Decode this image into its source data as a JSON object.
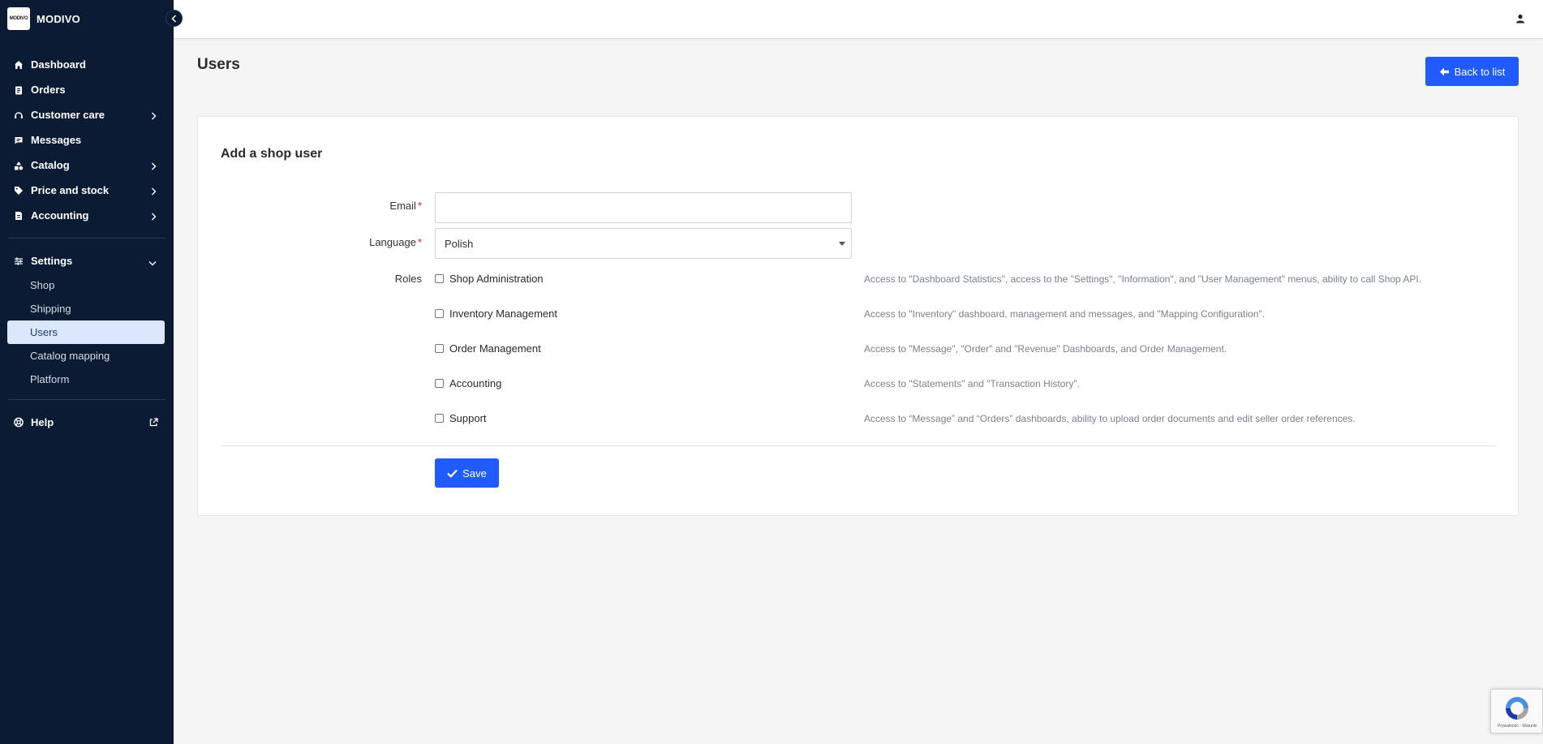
{
  "brand": {
    "logo_text": "MODIVO",
    "name": "MODIVO"
  },
  "sidebar": {
    "items": [
      {
        "label": "Dashboard",
        "icon": "home-icon",
        "has_chevron": false
      },
      {
        "label": "Orders",
        "icon": "clipboard-icon",
        "has_chevron": false
      },
      {
        "label": "Customer care",
        "icon": "headset-icon",
        "has_chevron": true
      },
      {
        "label": "Messages",
        "icon": "message-icon",
        "has_chevron": false
      },
      {
        "label": "Catalog",
        "icon": "shapes-icon",
        "has_chevron": true
      },
      {
        "label": "Price and stock",
        "icon": "tag-icon",
        "has_chevron": true
      },
      {
        "label": "Accounting",
        "icon": "invoice-icon",
        "has_chevron": true
      }
    ],
    "settings": {
      "label": "Settings",
      "icon": "sliders-icon",
      "expanded": true,
      "sub_items": [
        {
          "label": "Shop",
          "active": false
        },
        {
          "label": "Shipping",
          "active": false
        },
        {
          "label": "Users",
          "active": true
        },
        {
          "label": "Catalog mapping",
          "active": false
        },
        {
          "label": "Platform",
          "active": false
        }
      ]
    },
    "help": {
      "label": "Help",
      "icon": "lifebuoy-icon",
      "external_icon": "external-link-icon"
    }
  },
  "header": {
    "title": "Users",
    "back_button": "Back to list"
  },
  "form": {
    "title": "Add a shop user",
    "email": {
      "label": "Email",
      "value": "",
      "required": true
    },
    "language": {
      "label": "Language",
      "value": "Polish",
      "required": true
    },
    "roles_label": "Roles",
    "roles": [
      {
        "name": "Shop Administration",
        "checked": false,
        "description": "Access to \"Dashboard Statistics\", access to the \"Settings\", \"Information\", and \"User Management\" menus, ability to call Shop API."
      },
      {
        "name": "Inventory Management",
        "checked": false,
        "description": "Access to \"Inventory\" dashboard, management and messages, and \"Mapping Configuration\"."
      },
      {
        "name": "Order Management",
        "checked": false,
        "description": "Access to \"Message\", \"Order\" and \"Revenue\" Dashboards, and Order Management."
      },
      {
        "name": "Accounting",
        "checked": false,
        "description": "Access to \"Statements\" and \"Transaction History\"."
      },
      {
        "name": "Support",
        "checked": false,
        "description": "Access to “Message” and “Orders” dashboards, ability to upload order documents and edit seller order references."
      }
    ],
    "save_label": "Save"
  },
  "recaptcha": {
    "text": "Prywatność - Warunki"
  },
  "colors": {
    "sidebar_bg": "#0b1b33",
    "accent": "#1f5bff",
    "active_bg": "#dbe7fb",
    "required": "#d9232d"
  }
}
